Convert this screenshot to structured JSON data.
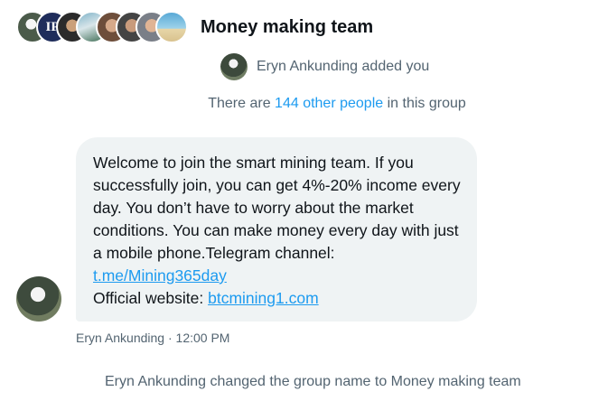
{
  "header": {
    "title": "Money making team",
    "avatar_stack": [
      {
        "icon": "member-avatar-photo"
      },
      {
        "icon": "member-avatar-initials",
        "initials": "IP"
      },
      {
        "icon": "member-avatar-photo"
      },
      {
        "icon": "member-avatar-photo"
      },
      {
        "icon": "member-avatar-photo"
      },
      {
        "icon": "member-avatar-photo"
      },
      {
        "icon": "member-avatar-photo"
      },
      {
        "icon": "member-avatar-beach"
      }
    ]
  },
  "system": {
    "added_text": "Eryn Ankunding added you",
    "count_prefix": "There are ",
    "count_link": "144 other people",
    "count_suffix": " in this group",
    "renamed_text": "Eryn Ankunding changed the group name to Money making team"
  },
  "message": {
    "body": "Welcome to join the smart mining team. If you successfully join, you can get 4%-20% income every day. You don’t have to worry about the market conditions. You can make money every day with just a mobile phone.Telegram channel:",
    "link1": "t.me/Mining365day",
    "website_label": "Official website: ",
    "link2": "btcmining1.com",
    "sender": "Eryn Ankunding",
    "separator": " · ",
    "time": "12:00 PM"
  },
  "colors": {
    "link": "#1d9bf0",
    "secondary_text": "#536471",
    "bubble_bg": "#eff3f4"
  }
}
